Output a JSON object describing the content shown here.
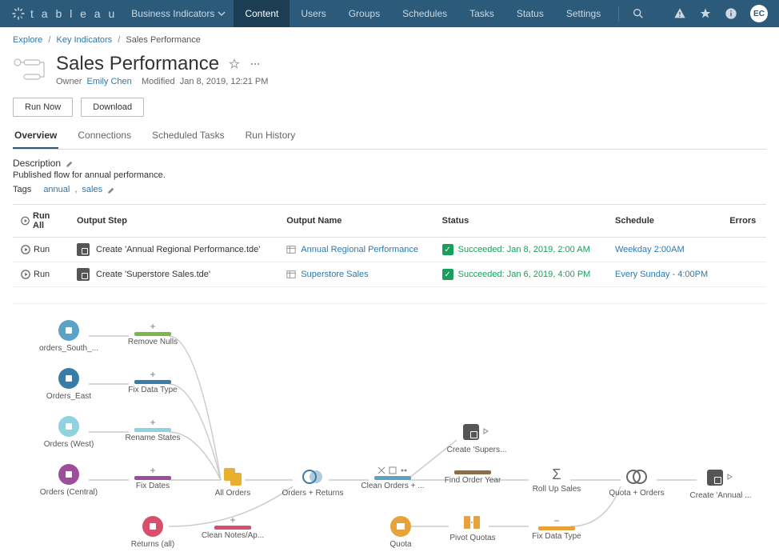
{
  "topnav": {
    "brand": "t a b l e a u",
    "site": "Business Indicators",
    "items": [
      "Content",
      "Users",
      "Groups",
      "Schedules",
      "Tasks",
      "Status",
      "Settings"
    ],
    "active_idx": 0,
    "avatar": "EC"
  },
  "breadcrumbs": {
    "items": [
      "Explore",
      "Key Indicators"
    ],
    "current": "Sales Performance"
  },
  "header": {
    "title": "Sales Performance",
    "owner_label": "Owner",
    "owner": "Emily Chen",
    "modified_label": "Modified",
    "modified": "Jan 8, 2019, 12:21 PM"
  },
  "buttons": {
    "run_now": "Run Now",
    "download": "Download"
  },
  "tabs": [
    "Overview",
    "Connections",
    "Scheduled Tasks",
    "Run History"
  ],
  "active_tab_idx": 0,
  "description": {
    "label": "Description",
    "text": "Published flow for annual performance."
  },
  "tags": {
    "label": "Tags",
    "items": [
      "annual",
      "sales"
    ]
  },
  "table": {
    "run_all": "Run All",
    "headers": {
      "output_step": "Output Step",
      "output_name": "Output Name",
      "status": "Status",
      "schedule": "Schedule",
      "errors": "Errors"
    },
    "run": "Run",
    "rows": [
      {
        "step": "Create 'Annual Regional Performance.tde'",
        "name": "Annual Regional Performance",
        "status": "Succeeded: Jan 8, 2019, 2:00 AM",
        "schedule": "Weekday 2:00AM"
      },
      {
        "step": "Create 'Superstore Sales.tde'",
        "name": "Superstore Sales",
        "status": "Succeeded: Jan 6, 2019, 4:00 PM",
        "schedule": "Every Sunday - 4:00PM"
      }
    ]
  },
  "flow": {
    "sources": [
      {
        "label": "orders_South_...",
        "color": "#5aa3c4"
      },
      {
        "label": "Orders_East",
        "color": "#3a7ca8"
      },
      {
        "label": "Orders (West)",
        "color": "#8fd3e0"
      },
      {
        "label": "Orders (Central)",
        "color": "#9b4f9b"
      },
      {
        "label": "Returns (all)",
        "color": "#d94f6b"
      }
    ],
    "clean": [
      {
        "label": "Remove Nulls",
        "color": "#7ab84a"
      },
      {
        "label": "Fix Data Type",
        "color": "#3a7ca8"
      },
      {
        "label": "Rename States",
        "color": "#8fd3e0"
      },
      {
        "label": "Fix Dates",
        "color": "#9b4f9b"
      },
      {
        "label": "Clean Notes/Ap...",
        "color": "#d94f6b"
      }
    ],
    "steps": {
      "all_orders": "All Orders",
      "orders_returns": "Orders + Returns",
      "clean_orders": "Clean Orders + ...",
      "find_year": "Find Order Year",
      "roll_up": "Roll Up Sales",
      "quota_orders": "Quota + Orders",
      "quota": "Quota",
      "pivot": "Pivot Quotas",
      "fix_type2": "Fix Data Type",
      "out_supers": "Create 'Supers...",
      "out_annual": "Create 'Annual ..."
    }
  }
}
